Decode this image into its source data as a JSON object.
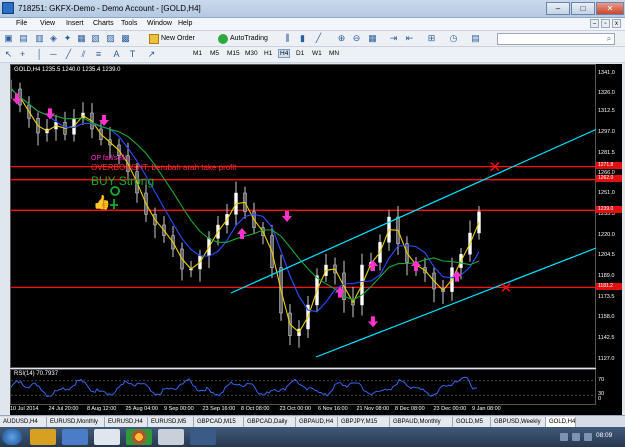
{
  "window": {
    "title": "718251: GKFX-Demo - Demo Account - [GOLD,H4]"
  },
  "menu": [
    "File",
    "View",
    "Insert",
    "Charts",
    "Tools",
    "Window",
    "Help"
  ],
  "toolbar": {
    "new_order": "New Order",
    "autotrading": "AutoTrading",
    "timeframes": [
      "M1",
      "M5",
      "M15",
      "M30",
      "H1",
      "H4",
      "D1",
      "W1",
      "MN"
    ],
    "active_timeframe": "H4",
    "search_placeholder": ""
  },
  "chart": {
    "symbol_info": "GOLD,H4  1235.5 1240.0 1235.4 1239.0",
    "annotation_op": "OP fail/sell/...",
    "annotation_overbought": "OVERBOUGHT, berubah arah take profit",
    "annotation_signal": "BUY Strong",
    "price_labels": [
      "1341.0",
      "1326.0",
      "1312.5",
      "1297.0",
      "1281.5",
      "1266.0",
      "1251.0",
      "1235.5",
      "1220.0",
      "1204.5",
      "1189.0",
      "1173.5",
      "1158.0",
      "1142.5",
      "1127.0"
    ],
    "price_tags": [
      "1271.8",
      "1262.0",
      "1239.0",
      "1181.2"
    ],
    "time_labels": [
      "10 Jul 2014",
      "24 Jul 20:00",
      "8 Aug 12:00",
      "25 Aug 04:00",
      "9 Sep 00:00",
      "23 Sep 16:00",
      "8 Oct 08:00",
      "23 Oct 00:00",
      "6 Nov 16:00",
      "21 Nov 08:00",
      "8 Dec 08:00",
      "23 Dec 00:00",
      "9 Jan 08:00"
    ],
    "rsi_label": "RSI(14) 70.7937",
    "rsi_levels": [
      "70",
      "30",
      "0"
    ],
    "colors": {
      "background": "#000000",
      "channel": "#00e5ff",
      "resistance": "#ff1010",
      "arrow": "#ff33cc",
      "ma_yellow": "#e8d000",
      "ma_green": "#19a830",
      "ma_blue": "#2a4dff",
      "candle": "#ffffff"
    },
    "chart_data": {
      "type": "line",
      "series": [
        {
          "values": [
            1330,
            1318,
            1308,
            1297,
            1300,
            1305,
            1296,
            1308,
            1312,
            1300,
            1292,
            1288,
            1280,
            1268,
            1252,
            1236,
            1228,
            1220,
            1210,
            1195,
            1195,
            1205,
            1218,
            1228,
            1236,
            1252,
            1238,
            1226,
            1220,
            1196,
            1162,
            1145,
            1150,
            1168,
            1190,
            1198,
            1192,
            1172,
            1168,
            1198,
            1200,
            1215,
            1234,
            1214,
            1200,
            1196,
            1192,
            1180,
            1178,
            1196,
            1206,
            1222,
            1238
          ]
        }
      ]
    }
  },
  "tabs": [
    "AUDUSD,H4",
    "EURUSD,Monthly",
    "EURUSD,H4",
    "EURUSD,M5",
    "GBPCAD,M15",
    "GBPCAD,Daily",
    "GBPAUD,H4",
    "GBPJPY,M15",
    "GBPAUD,Monthly",
    "GOLD,M5",
    "GBPUSD,Weekly",
    "GOLD,H4"
  ],
  "active_tab": "GOLD,H4",
  "taskbar": {
    "clock": "08:09"
  }
}
